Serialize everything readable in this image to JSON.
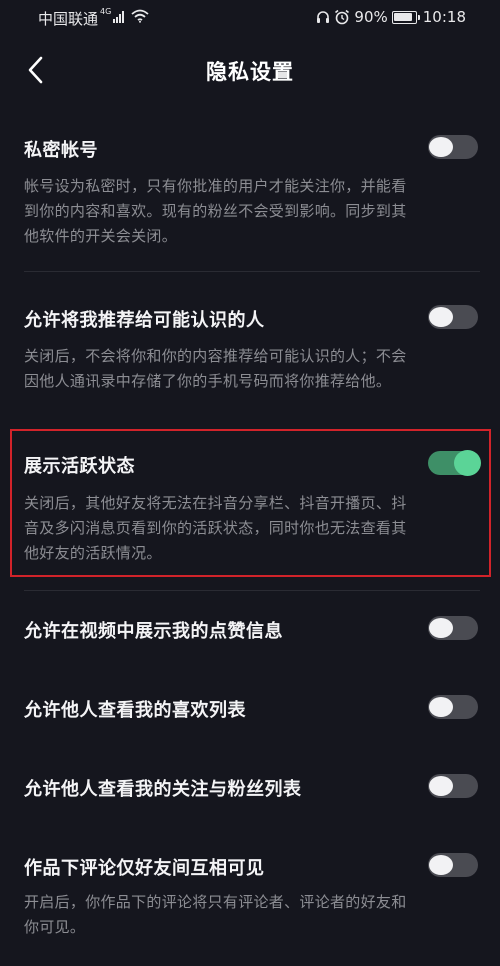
{
  "status_bar": {
    "carrier": "中国联通",
    "network_type": "4G",
    "battery": "90%",
    "battery_level": 0.9,
    "time": "10:18",
    "icons": [
      "signal-icon",
      "wifi-icon",
      "headset-icon",
      "alarm-icon",
      "battery-icon"
    ]
  },
  "header": {
    "title": "隐私设置",
    "back_icon": "chevron-left-icon"
  },
  "settings": [
    {
      "title": "私密帐号",
      "enabled": false,
      "description": [
        "帐号设为私密时，只有你批准的用户才能关注你，并能看",
        "到你的内容和喜欢。现有的粉丝不会受到影响。同步到其",
        "他软件的开关会关闭。"
      ]
    },
    {
      "title": "允许将我推荐给可能认识的人",
      "enabled": false,
      "description": [
        "关闭后，不会将你和你的内容推荐给可能认识的人；不会",
        "因他人通讯录中存储了你的手机号码而将你推荐给他。"
      ]
    },
    {
      "title": "展示活跃状态",
      "enabled": true,
      "highlighted": true,
      "description": [
        "关闭后，其他好友将无法在抖音分享栏、抖音开播页、抖",
        "音及多闪消息页看到你的活跃状态，同时你也无法查看其",
        "他好友的活跃情况。"
      ]
    },
    {
      "title": "允许在视频中展示我的点赞信息",
      "enabled": false
    },
    {
      "title": "允许他人查看我的喜欢列表",
      "enabled": false
    },
    {
      "title": "允许他人查看我的关注与粉丝列表",
      "enabled": false
    },
    {
      "title": "作品下评论仅好友间互相可见",
      "enabled": false,
      "description": [
        "开启后，你作品下的评论将只有评论者、评论者的好友和",
        "你可见。"
      ]
    }
  ],
  "colors": {
    "background": "#15161e",
    "toggle_on": "#5bd497",
    "toggle_off": "#4a4b52",
    "highlight_border": "#d2232a",
    "description_text": "#8c8d93"
  }
}
